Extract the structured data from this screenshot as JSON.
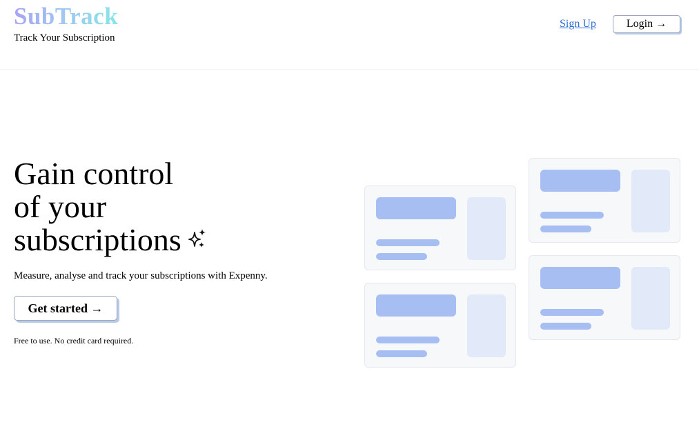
{
  "header": {
    "brand": "SubTrack",
    "tagline": "Track Your Subscription",
    "signup_label": "Sign Up",
    "login_label": "Login →"
  },
  "hero": {
    "title_lines": [
      "Gain control",
      "of your",
      "subscriptions"
    ],
    "subtitle": "Measure, analyse and track your subscriptions with Expenny.",
    "cta_label": "Get started →",
    "footnote": "Free to use. No credit card required."
  },
  "illustration": {
    "card_count": 4,
    "block_color": "#a6bef2",
    "side_color": "#e2e9f8",
    "card_bg": "#f7f8fa"
  },
  "colors": {
    "brand_gradient": [
      "#a9a3f5",
      "#9fc9f2",
      "#87e6e6"
    ],
    "link": "#2d6fd6",
    "button_shadow": "#b6c9e7"
  }
}
